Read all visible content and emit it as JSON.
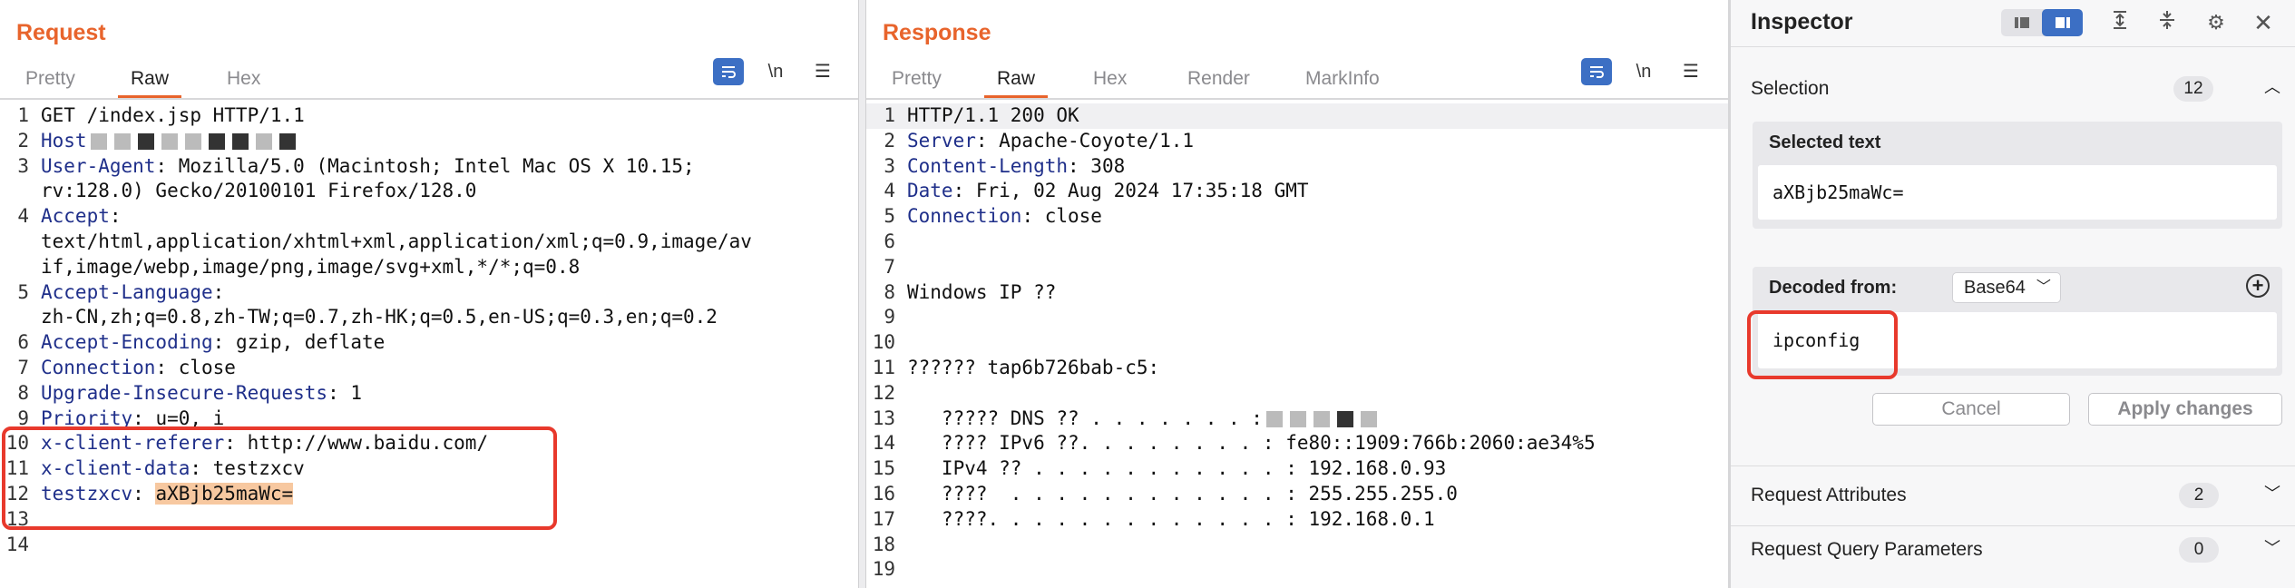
{
  "request": {
    "title": "Request",
    "tabs": [
      "Pretty",
      "Raw",
      "Hex"
    ],
    "active_tab": "Raw",
    "newline_label": "\\n",
    "lines": [
      {
        "n": "1",
        "key": "",
        "val": "GET /index.jsp HTTP/1.1"
      },
      {
        "n": "2",
        "key": "Host",
        "val": ""
      },
      {
        "n": "3",
        "key": "User-Agent",
        "val": ": Mozilla/5.0 (Macintosh; Intel Mac OS X 10.15;"
      },
      {
        "n": "",
        "key": "",
        "val": "rv:128.0) Gecko/20100101 Firefox/128.0"
      },
      {
        "n": "4",
        "key": "Accept",
        "val": ":"
      },
      {
        "n": "",
        "key": "",
        "val": "text/html,application/xhtml+xml,application/xml;q=0.9,image/av"
      },
      {
        "n": "",
        "key": "",
        "val": "if,image/webp,image/png,image/svg+xml,*/*;q=0.8"
      },
      {
        "n": "5",
        "key": "Accept-Language",
        "val": ":"
      },
      {
        "n": "",
        "key": "",
        "val": "zh-CN,zh;q=0.8,zh-TW;q=0.7,zh-HK;q=0.5,en-US;q=0.3,en;q=0.2"
      },
      {
        "n": "6",
        "key": "Accept-Encoding",
        "val": ": gzip, deflate"
      },
      {
        "n": "7",
        "key": "Connection",
        "val": ": close"
      },
      {
        "n": "8",
        "key": "Upgrade-Insecure-Requests",
        "val": ": 1"
      },
      {
        "n": "9",
        "key": "Priority",
        "val": ": u=0, i"
      },
      {
        "n": "10",
        "key": "x-client-referer",
        "val": ": http://www.baidu.com/"
      },
      {
        "n": "11",
        "key": "x-client-data",
        "val": ": testzxcv"
      },
      {
        "n": "12",
        "key": "testzxcv",
        "val": ": ",
        "hl": "aXBjb25maWc="
      },
      {
        "n": "13",
        "key": "",
        "val": ""
      },
      {
        "n": "14",
        "key": "",
        "val": ""
      }
    ]
  },
  "response": {
    "title": "Response",
    "tabs": [
      "Pretty",
      "Raw",
      "Hex",
      "Render",
      "MarkInfo"
    ],
    "active_tab": "Raw",
    "newline_label": "\\n",
    "lines": [
      {
        "n": "1",
        "key": "",
        "val": "HTTP/1.1 200 OK"
      },
      {
        "n": "2",
        "key": "Server",
        "val": ": Apache-Coyote/1.1"
      },
      {
        "n": "3",
        "key": "Content-Length",
        "val": ": 308"
      },
      {
        "n": "4",
        "key": "Date",
        "val": ": Fri, 02 Aug 2024 17:35:18 GMT"
      },
      {
        "n": "5",
        "key": "Connection",
        "val": ": close"
      },
      {
        "n": "6",
        "key": "",
        "val": ""
      },
      {
        "n": "7",
        "key": "",
        "val": ""
      },
      {
        "n": "8",
        "key": "",
        "val": "Windows IP ??"
      },
      {
        "n": "9",
        "key": "",
        "val": ""
      },
      {
        "n": "10",
        "key": "",
        "val": ""
      },
      {
        "n": "11",
        "key": "",
        "val": "?????? tap6b726bab-c5:"
      },
      {
        "n": "12",
        "key": "",
        "val": ""
      },
      {
        "n": "13",
        "key": "",
        "val": "   ????? DNS ?? . . . . . . . :"
      },
      {
        "n": "14",
        "key": "",
        "val": "   ???? IPv6 ??. . . . . . . . : fe80::1909:766b:2060:ae34%5"
      },
      {
        "n": "15",
        "key": "",
        "val": "   IPv4 ?? . . . . . . . . . . . : 192.168.0.93"
      },
      {
        "n": "16",
        "key": "",
        "val": "   ????  . . . . . . . . . . . . : 255.255.255.0"
      },
      {
        "n": "17",
        "key": "",
        "val": "   ????. . . . . . . . . . . . . : 192.168.0.1"
      },
      {
        "n": "18",
        "key": "",
        "val": ""
      },
      {
        "n": "19",
        "key": "",
        "val": ""
      }
    ]
  },
  "inspector": {
    "title": "Inspector",
    "selection": {
      "label": "Selection",
      "count": "12"
    },
    "selected_text": {
      "label": "Selected text",
      "value": "aXBjb25maWc="
    },
    "decoded": {
      "label": "Decoded from:",
      "encoding": "Base64",
      "value": "ipconfig"
    },
    "cancel_label": "Cancel",
    "apply_label": "Apply changes",
    "attributes": {
      "label": "Request Attributes",
      "count": "2"
    },
    "query_params": {
      "label": "Request Query Parameters",
      "count": "0"
    }
  },
  "colors": {
    "accent": "#e8642c",
    "header_key": "#1f2f8a",
    "highlight": "#f7c8a0",
    "annotation": "#e8392c",
    "button_blue": "#3c6fc4"
  }
}
